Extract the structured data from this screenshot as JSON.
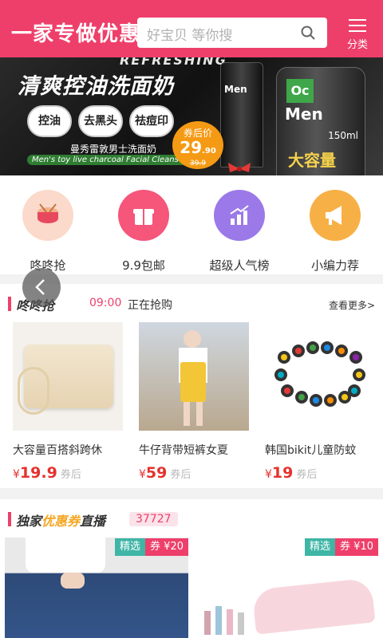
{
  "header": {
    "title": "一家专做优惠",
    "search_placeholder": "好宝贝 等你搜",
    "category_label": "分类"
  },
  "banner": {
    "refresh": "REFRESHING",
    "headline": "清爽控油洗面奶",
    "pills": [
      "控油",
      "去黑头",
      "祛痘印"
    ],
    "subtitle_cn": "曼秀雷敦男士洗面奶",
    "subtitle_en": "Men's toy live charcoal Facial Cleanser",
    "price_label": "券后价",
    "price": "29",
    "price_cents": ".90",
    "orig_price": "39.9",
    "tube_brand": "Men",
    "bottle_code": "Oc",
    "bottle_brand": "Men",
    "bottle_volume": "150ml",
    "bottle_slogan": "大容量"
  },
  "icons": [
    {
      "label": "咚咚抢",
      "color": "#fbd9cb"
    },
    {
      "label": "9.9包邮",
      "color": "#f5567a"
    },
    {
      "label": "超级人气榜",
      "color": "#9b79e8"
    },
    {
      "label": "小编力荐",
      "color": "#f7b046"
    }
  ],
  "section1": {
    "title": "咚咚抢",
    "time": "09:00",
    "status": "正在抢购",
    "more": "查看更多>",
    "products": [
      {
        "name": "大容量百搭斜跨休",
        "currency": "¥",
        "price": "19.9",
        "after": "券后"
      },
      {
        "name": "牛仔背带短裤女夏",
        "currency": "¥",
        "price": "59",
        "after": "券后"
      },
      {
        "name": "韩国bikit儿童防蚊",
        "currency": "¥",
        "price": "19",
        "after": "券后"
      }
    ]
  },
  "section2": {
    "title_a": "独家",
    "title_b": "优惠券",
    "title_c": "直播",
    "count": "37727",
    "cards": [
      {
        "tag1": "精选",
        "tag2": "券 ¥20"
      },
      {
        "tag1": "精选",
        "tag2": "券 ¥10"
      }
    ]
  }
}
